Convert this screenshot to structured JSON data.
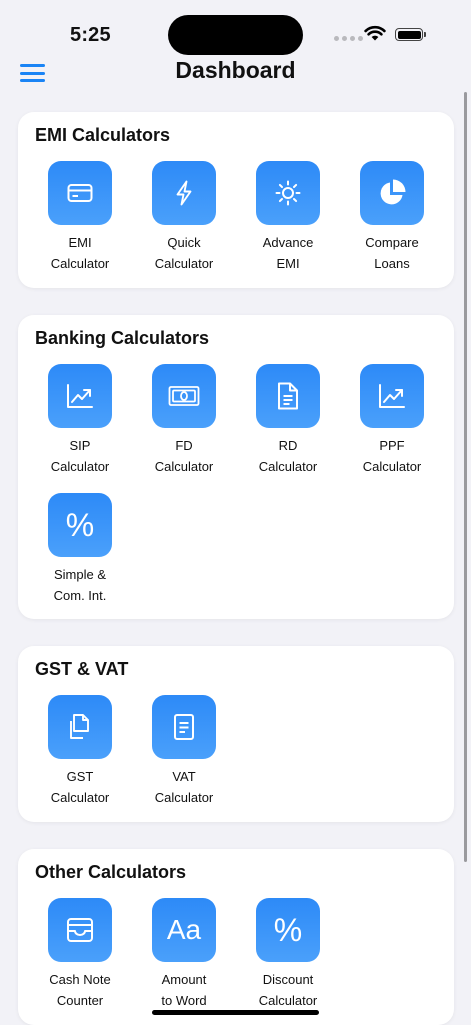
{
  "status_bar": {
    "time": "5:25"
  },
  "header": {
    "title": "Dashboard",
    "menu_icon": "hamburger-icon"
  },
  "colors": {
    "accent": "#1a84f5",
    "tile_gradient_top": "#2d8af7",
    "tile_gradient_bottom": "#4aa0fb",
    "background": "#f2f2f7",
    "card": "#ffffff"
  },
  "sections": [
    {
      "title": "EMI Calculators",
      "items": [
        {
          "label": "EMI\nCalculator",
          "icon": "credit-card-icon"
        },
        {
          "label": "Quick\nCalculator",
          "icon": "lightning-bolt-icon"
        },
        {
          "label": "Advance\nEMI",
          "icon": "sun-icon"
        },
        {
          "label": "Compare\nLoans",
          "icon": "pie-chart-icon"
        }
      ]
    },
    {
      "title": "Banking Calculators",
      "items": [
        {
          "label": "SIP\nCalculator",
          "icon": "chart-line-up-icon"
        },
        {
          "label": "FD\nCalculator",
          "icon": "banknote-icon"
        },
        {
          "label": "RD\nCalculator",
          "icon": "document-icon"
        },
        {
          "label": "PPF\nCalculator",
          "icon": "chart-line-up-icon"
        },
        {
          "label": "Simple &\nCom. Int.",
          "icon": "percent-icon"
        }
      ]
    },
    {
      "title": "GST & VAT",
      "items": [
        {
          "label": "GST\nCalculator",
          "icon": "documents-icon"
        },
        {
          "label": "VAT\nCalculator",
          "icon": "receipt-icon"
        }
      ]
    },
    {
      "title": "Other Calculators",
      "items": [
        {
          "label": "Cash Note\nCounter",
          "icon": "tray-icon"
        },
        {
          "label": "Amount\nto Word",
          "icon": "text-format-icon",
          "glyph": "Aa"
        },
        {
          "label": "Discount\nCalculator",
          "icon": "percent-icon"
        }
      ]
    }
  ]
}
